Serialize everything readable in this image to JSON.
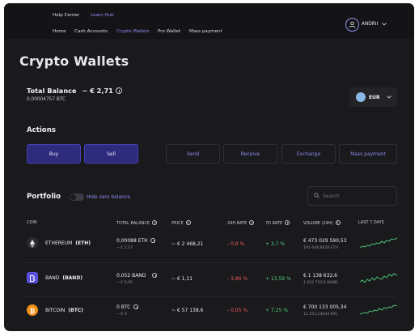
{
  "topnav": {
    "help_center": "Help Center",
    "learn_hub": "Learn Hub",
    "home": "Home",
    "cash_accounts": "Cash Accounts",
    "crypto_wallets": "Crypto Wallets",
    "pro_wallet": "Pro Wallet",
    "mass_payment": "Mass payment",
    "user_name": "ANDRII"
  },
  "page": {
    "title": "Crypto Wallets",
    "balance_label": "Total Balance",
    "balance_value": "~ € 2,71",
    "balance_btc": "0,00004757 BTC",
    "currency": "EUR"
  },
  "actions": {
    "title": "Actions",
    "buy": "Buy",
    "sell": "Sell",
    "send": "Send",
    "receive": "Receive",
    "exchange": "Exchange",
    "mass_payment": "Mass payment"
  },
  "portfolio": {
    "title": "Portfolio",
    "hide_zero": "Hide zero balance",
    "search_placeholder": "Search"
  },
  "table": {
    "headers": {
      "coin": "COIN",
      "total_balance": "TOTAL BALANCE",
      "price": "PRICE",
      "rate_24h": "24H RATE",
      "rate_7d": "7D RATE",
      "volume": "VOLUME (24H)",
      "last7": "LAST 7 DAYS"
    },
    "rows": [
      {
        "name": "ETHEREUM",
        "symbol": "(ETH)",
        "balance": "0,00088 ETH",
        "balance_eur": "~ € 2,17",
        "price": "~ € 2 468,21",
        "rate_24h": "- 0,8 %",
        "rate_7d": "+ 3,7 %",
        "volume": "€ 473 029 590,53",
        "volume_sub": "191 648,8429 ETH",
        "icon": "ethereum-icon",
        "icon_color": "#e9e9f2"
      },
      {
        "name": "BAND",
        "symbol": "(BAND)",
        "balance": "0,052 BAND",
        "balance_eur": "~ € 0,05",
        "price": "~ € 1,11",
        "rate_24h": "- 3,86 %",
        "rate_7d": "+ 13,59 %",
        "volume": "€ 1 138 632,6",
        "volume_sub": "1 022 753,6 BAND",
        "icon": "band-icon",
        "icon_color": "#5b4fe0"
      },
      {
        "name": "BITCOIN",
        "symbol": "(BTC)",
        "balance": "0 BTC",
        "balance_eur": "~ € 0",
        "price": "~ € 57 138,6",
        "rate_24h": "- 0,05 %",
        "rate_7d": "+ 7,25 %",
        "volume": "€ 700 133 005,34",
        "volume_sub": "12 253,24044 BTC",
        "icon": "bitcoin-icon",
        "icon_color": "#f0921a"
      }
    ]
  },
  "colors": {
    "accent": "#8e8cf2",
    "negative": "#ee5a5a",
    "positive": "#4fd17d",
    "background": "#1a1a1d"
  }
}
